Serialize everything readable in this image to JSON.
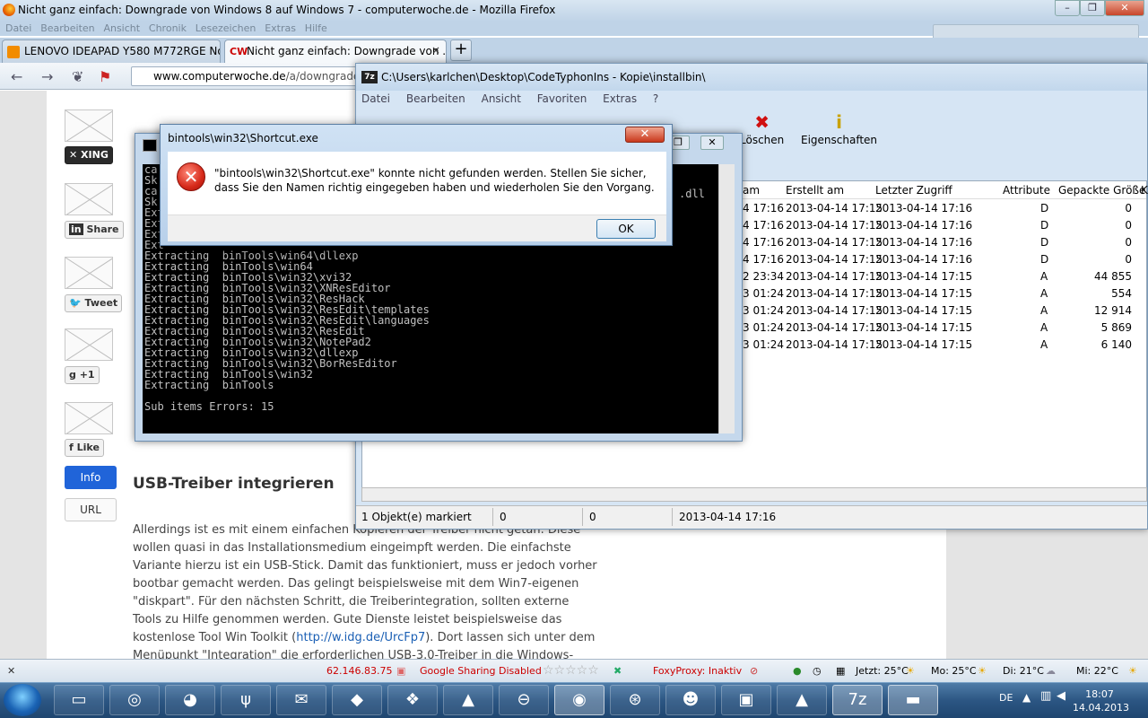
{
  "firefox": {
    "title": "Nicht ganz einfach: Downgrade von Windows 8 auf Windows 7 - computerwoche.de - Mozilla Firefox",
    "menu": [
      "Datei",
      "Bearbeiten",
      "Ansicht",
      "Chronik",
      "Lesezeichen",
      "Extras",
      "Hilfe"
    ],
    "tabs": [
      {
        "label": "LENOVO IDEAPAD Y580 M772RGE No...",
        "close": "×"
      },
      {
        "label": "Nicht ganz einfach: Downgrade von ...",
        "close": "×"
      }
    ],
    "new_tab": "+",
    "url_host": "www.computerwoche.de",
    "url_path": "/a/downgrade-vo",
    "status": {
      "ip": "62.146.83.75",
      "google_sharing": "Google Sharing Disabled",
      "foxyproxy": "FoxyProxy: Inaktiv",
      "weather": [
        "Jetzt: 25°C",
        "Mo: 25°C",
        "Di: 21°C",
        "Mi: 22°C"
      ]
    }
  },
  "page": {
    "share_buttons": [
      {
        "label": "XING",
        "icon": "xing-icon"
      },
      {
        "label": "Share",
        "icon": "linkedin-icon"
      },
      {
        "label": "Tweet",
        "icon": "twitter-icon"
      },
      {
        "label": "+1",
        "icon": "google-plus-icon"
      },
      {
        "label": "Like",
        "icon": "facebook-icon"
      }
    ],
    "info_button": "Info",
    "url_button": "URL",
    "heading": "USB-Treiber integrieren",
    "para_before_link": "Allerdings ist es mit einem einfachen Kopieren der Treiber nicht getan. Diese wollen quasi in das Installationsmedium eingeimpft werden. Die einfachste Variante hierzu ist ein USB-Stick. Damit das funktioniert, muss er jedoch vorher bootbar gemacht werden. Das gelingt beispielsweise mit dem Win7-eigenen \"diskpart\". Für den nächsten Schritt, die Treiberintegration, sollten externe Tools zu Hilfe genommen werden. Gute Dienste leistet beispielsweise das kostenlose Tool Win Toolkit (",
    "link": "http://w.idg.de/UrcFp7",
    "para_after_link": "). Dort lassen sich unter dem Menüpunkt \"Integration\" die erforderlichen USB-3.0-Treiber in die Windows-"
  },
  "zip": {
    "title": "C:\\Users\\karlchen\\Desktop\\CodeTyphonIns - Kopie\\installbin\\",
    "menu": [
      "Datei",
      "Bearbeiten",
      "Ansicht",
      "Favoriten",
      "Extras",
      "?"
    ],
    "toolbar": [
      "Löschen",
      "Eigenschaften"
    ],
    "columns": [
      "am",
      "Erstellt am",
      "Letzter Zugriff",
      "Attribute",
      "Gepackte Größe",
      "K"
    ],
    "rows": [
      {
        "mod": "4 17:16",
        "created": "2013-04-14 17:15",
        "access": "2013-04-14 17:16",
        "attr": "D",
        "size": "0"
      },
      {
        "mod": "4 17:16",
        "created": "2013-04-14 17:15",
        "access": "2013-04-14 17:16",
        "attr": "D",
        "size": "0"
      },
      {
        "mod": "4 17:16",
        "created": "2013-04-14 17:15",
        "access": "2013-04-14 17:16",
        "attr": "D",
        "size": "0"
      },
      {
        "mod": "4 17:16",
        "created": "2013-04-14 17:15",
        "access": "2013-04-14 17:16",
        "attr": "D",
        "size": "0"
      },
      {
        "mod": "2 23:34",
        "created": "2013-04-14 17:15",
        "access": "2013-04-14 17:15",
        "attr": "A",
        "size": "44 855"
      },
      {
        "mod": "3 01:24",
        "created": "2013-04-14 17:15",
        "access": "2013-04-14 17:15",
        "attr": "A",
        "size": "554"
      },
      {
        "mod": "3 01:24",
        "created": "2013-04-14 17:15",
        "access": "2013-04-14 17:15",
        "attr": "A",
        "size": "12 914"
      },
      {
        "mod": "3 01:24",
        "created": "2013-04-14 17:15",
        "access": "2013-04-14 17:15",
        "attr": "A",
        "size": "5 869"
      },
      {
        "mod": "3 01:24",
        "created": "2013-04-14 17:15",
        "access": "2013-04-14 17:15",
        "attr": "A",
        "size": "6 140"
      }
    ],
    "status": [
      "1 Objekt(e) markiert",
      "0",
      "0",
      "2013-04-14 17:16"
    ]
  },
  "console": {
    "lines": [
      "ca",
      "Sk",
      "ca",
      "Sk",
      "Ext",
      "Ext",
      "Ext",
      "Ext",
      "Extracting  binTools\\win64\\dllexp",
      "Extracting  binTools\\win64",
      "Extracting  binTools\\win32\\xvi32",
      "Extracting  binTools\\win32\\XNResEditor",
      "Extracting  binTools\\win32\\ResHack",
      "Extracting  binTools\\win32\\ResEdit\\templates",
      "Extracting  binTools\\win32\\ResEdit\\languages",
      "Extracting  binTools\\win32\\ResEdit",
      "Extracting  binTools\\win32\\NotePad2",
      "Extracting  binTools\\win32\\dllexp",
      "Extracting  binTools\\win32\\BorResEditor",
      "Extracting  binTools\\win32",
      "Extracting  binTools",
      "",
      "Sub items Errors: 15"
    ],
    "right_fragment": ".dll"
  },
  "error": {
    "title": "bintools\\win32\\Shortcut.exe",
    "message": "\"bintools\\win32\\Shortcut.exe\" konnte nicht gefunden werden. Stellen Sie sicher, dass Sie den Namen richtig eingegeben haben und wiederholen Sie den Vorgang.",
    "ok": "OK"
  },
  "taskbar": {
    "language": "DE",
    "time": "18:07",
    "date": "14.04.2013"
  }
}
